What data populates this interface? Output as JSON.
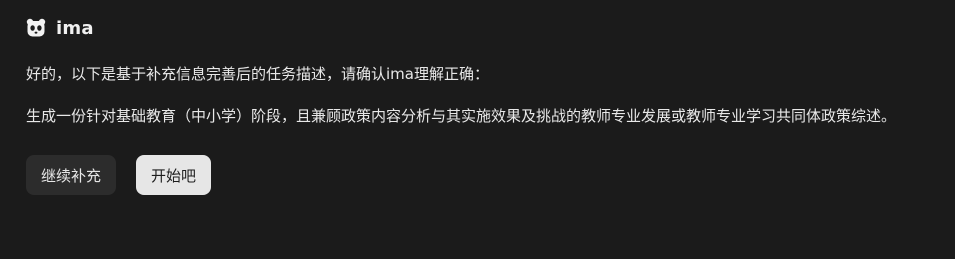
{
  "assistant": {
    "name": "ima",
    "avatar_icon": "panda-icon"
  },
  "message": {
    "intro": "好的，以下是基于补充信息完善后的任务描述，请确认ima理解正确：",
    "task": "生成一份针对基础教育（中小学）阶段，且兼顾政策内容分析与其实施效果及挑战的教师专业发展或教师专业学习共同体政策综述。"
  },
  "actions": {
    "continue_label": "继续补充",
    "start_label": "开始吧"
  },
  "colors": {
    "background": "#1b1b1b",
    "text": "#e8e8e8",
    "secondary_button": "#2c2c2c",
    "primary_button": "#e6e6e6"
  }
}
